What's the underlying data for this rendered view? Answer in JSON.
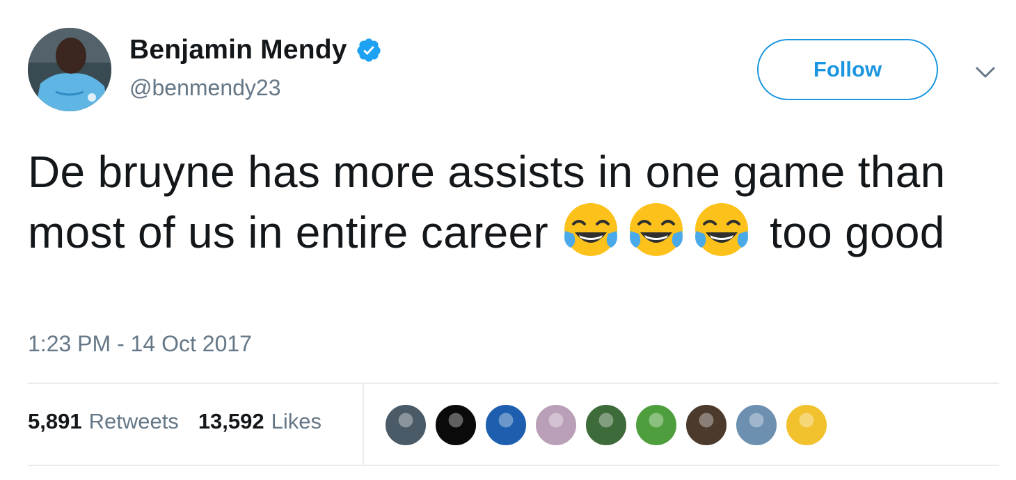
{
  "tweet": {
    "author": {
      "name": "Benjamin Mendy",
      "handle": "@benmendy23",
      "verified": true,
      "avatar_icon": "profile-photo"
    },
    "follow_label": "Follow",
    "caret_icon": "chevron-down-icon",
    "text_part1": "De bruyne has more assists in one game than most of us in entire career",
    "emoji": [
      "face-with-tears-of-joy",
      "face-with-tears-of-joy",
      "face-with-tears-of-joy"
    ],
    "text_part2": "too good",
    "timestamp": "1:23 PM - 14 Oct 2017"
  },
  "stats": {
    "retweets_count": "5,891",
    "retweets_label": "Retweets",
    "likes_count": "13,592",
    "likes_label": "Likes"
  },
  "liker_avatars": [
    {
      "name": "liker-avatar-1",
      "color": "#4a5a66"
    },
    {
      "name": "liker-avatar-2",
      "color": "#0a0a0a"
    },
    {
      "name": "liker-avatar-3",
      "color": "#1d5fae"
    },
    {
      "name": "liker-avatar-4",
      "color": "#b9a0b8"
    },
    {
      "name": "liker-avatar-5",
      "color": "#3d6b3a"
    },
    {
      "name": "liker-avatar-6",
      "color": "#4f9e3e"
    },
    {
      "name": "liker-avatar-7",
      "color": "#4c3a2c"
    },
    {
      "name": "liker-avatar-8",
      "color": "#6d8fb0"
    },
    {
      "name": "liker-avatar-9",
      "color": "#f2c12e"
    }
  ],
  "colors": {
    "accent": "#1b95e0",
    "secondary_text": "#657786",
    "divider": "#e6ecf0"
  }
}
